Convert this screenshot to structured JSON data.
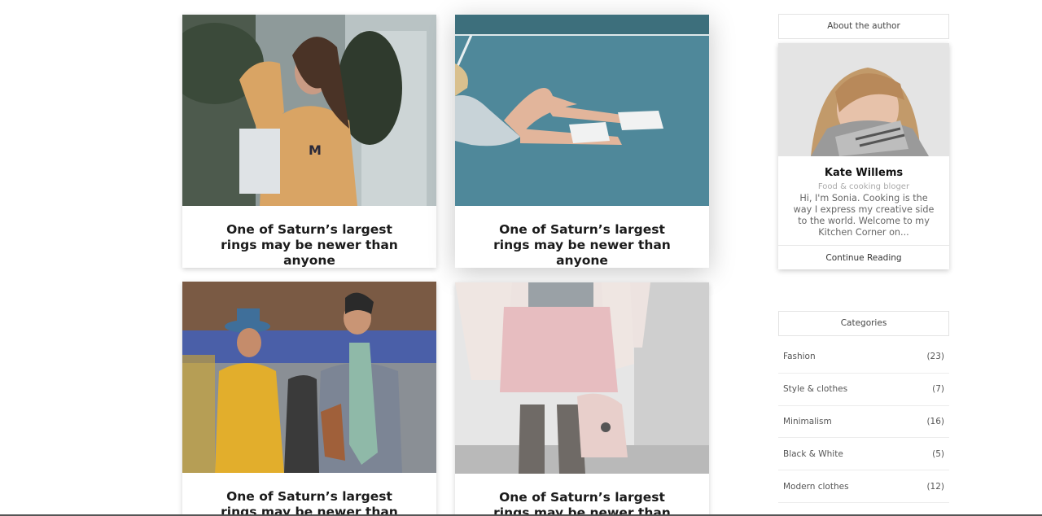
{
  "posts": [
    {
      "title": "One of Saturn’s largest rings may be newer than anyone"
    },
    {
      "title": "One of Saturn’s largest rings may be newer than anyone"
    },
    {
      "title": "One of Saturn’s largest rings may be newer than anyone"
    },
    {
      "title": "One of Saturn’s largest rings may be newer than anyone"
    }
  ],
  "author": {
    "section_title": "About the author",
    "name": "Kate Willems",
    "role": "Food & cooking bloger",
    "bio": "Hi, I'm Sonia. Cooking is the way I express my creative side to the world. Welcome to my Kitchen Corner on...",
    "link_label": "Continue Reading"
  },
  "categories": {
    "section_title": "Categories",
    "items": [
      {
        "label": "Fashion",
        "count": "(23)"
      },
      {
        "label": "Style & clothes",
        "count": "(7)"
      },
      {
        "label": "Minimalism",
        "count": "(16)"
      },
      {
        "label": "Black & White",
        "count": "(5)"
      },
      {
        "label": "Modern clothes",
        "count": "(12)"
      }
    ]
  }
}
